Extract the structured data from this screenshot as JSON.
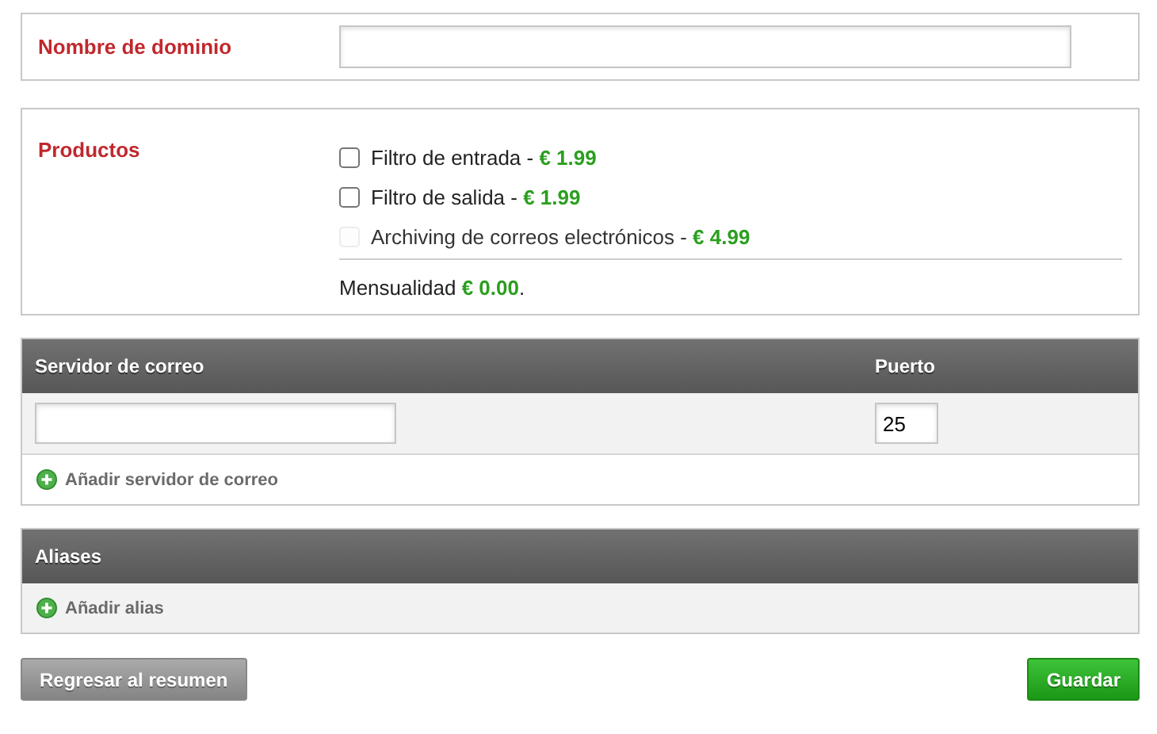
{
  "domain": {
    "label": "Nombre de dominio"
  },
  "products": {
    "label": "Productos",
    "items": [
      {
        "name": "Filtro de entrada - ",
        "price": "€ 1.99",
        "checked": false,
        "disabled": false
      },
      {
        "name": "Filtro de salida - ",
        "price": "€ 1.99",
        "checked": false,
        "disabled": false
      },
      {
        "name": "Archiving de correos electrónicos - ",
        "price": "€ 4.99",
        "checked": false,
        "disabled": true
      }
    ],
    "total": {
      "label": "Mensualidad ",
      "amount": "€ 0.00",
      "suffix": "."
    }
  },
  "mail_servers": {
    "columns": [
      "Servidor de correo",
      "Puerto"
    ],
    "rows": [
      {
        "port": "25"
      }
    ],
    "add_link": "Añadir servidor de correo"
  },
  "aliases": {
    "title": "Aliases",
    "add_link": "Añadir alias"
  },
  "buttons": {
    "back": "Regresar al resumen",
    "save": "Guardar"
  }
}
